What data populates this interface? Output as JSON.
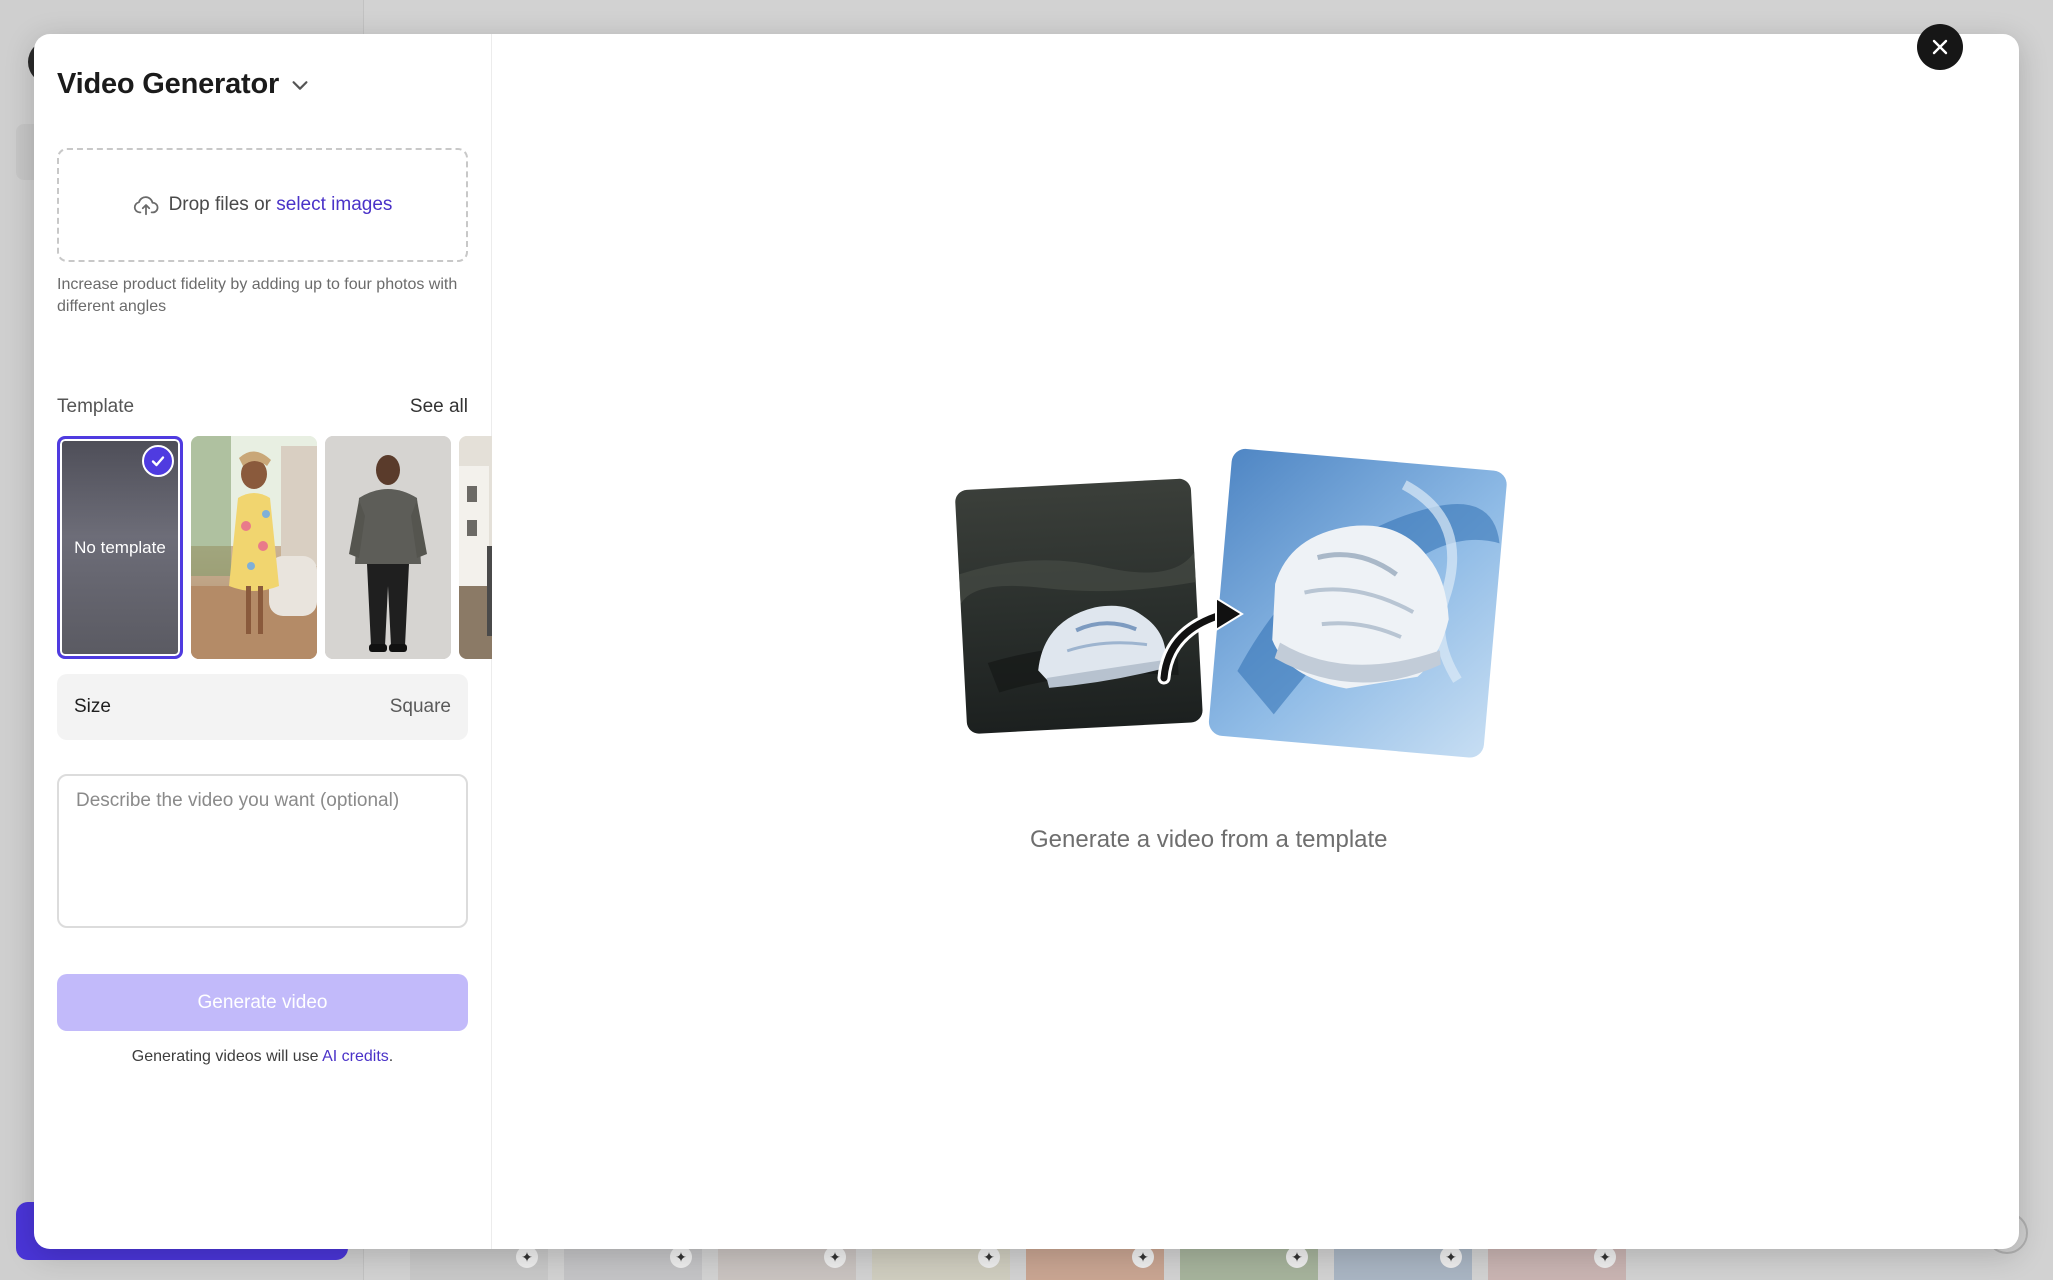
{
  "modal": {
    "title": "Video Generator",
    "upload": {
      "text": "Drop files or",
      "link": "select images",
      "hint": "Increase product fidelity by adding up to four photos with different angles"
    },
    "template": {
      "label": "Template",
      "see_all": "See all",
      "items": [
        {
          "label": "No template",
          "selected": true
        },
        {
          "label": "",
          "selected": false
        },
        {
          "label": "",
          "selected": false
        },
        {
          "label": "",
          "selected": false
        }
      ]
    },
    "size": {
      "label": "Size",
      "value": "Square"
    },
    "prompt": {
      "placeholder": "Describe the video you want (optional)",
      "value": ""
    },
    "generate_button": "Generate video",
    "credits_note": {
      "text": "Generating videos will use",
      "link": "AI credits",
      "suffix": "."
    },
    "preview": {
      "caption": "Generate a video from a template"
    }
  },
  "icons": {
    "title_chevron": "chevron-down-icon",
    "upload": "upload-cloud-icon",
    "selected": "check-icon",
    "close": "close-icon",
    "background_thumb": "sparkle-icon"
  },
  "colors": {
    "accent": "#4f3be0",
    "link": "#4a32c8",
    "button_disabled": "#c2bafa",
    "close_button": "#161616"
  }
}
